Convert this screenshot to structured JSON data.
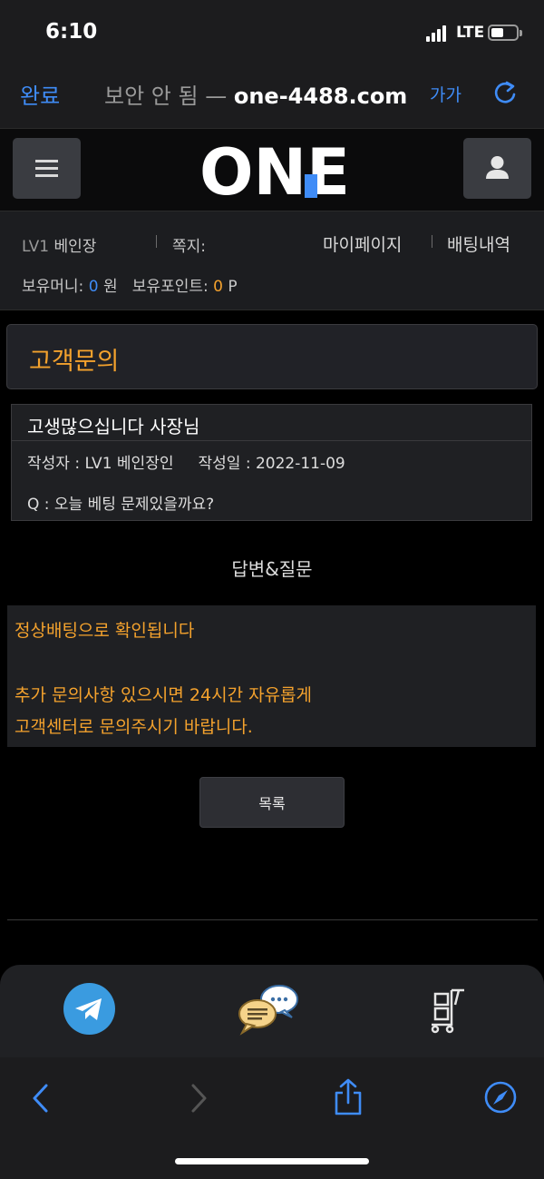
{
  "status_bar": {
    "time": "6:10",
    "network": "LTE"
  },
  "browser": {
    "done_label": "완료",
    "insecure_label": "보안 안 됨",
    "dash": "—",
    "domain": "one-4488.com",
    "text_size_label": "가가"
  },
  "header": {
    "logo_text": "ONE"
  },
  "user_info": {
    "level": "LV1",
    "name": "베인장",
    "memo_label": "쪽지:",
    "mypage_label": "마이페이지",
    "betting_history_label": "배팅내역",
    "money_label": "보유머니:",
    "money_value": "0",
    "money_unit": "원",
    "points_label": "보유포인트:",
    "points_value": "0",
    "points_unit": "P"
  },
  "page": {
    "title": "고객문의"
  },
  "question": {
    "subject": "고생많으십니다 사장님",
    "author_label": "작성자 : LV1 베인장인",
    "date_label": "작성일 : 2022-11-09",
    "body": "Q : 오늘 베팅 문제있을까요?"
  },
  "answer": {
    "heading": "답변&질문",
    "line1": "정상배팅으로 확인됩니다",
    "line2": "추가 문의사항 있으시면 24시간 자유롭게",
    "line3": "고객센터로 문의주시기 바랍니다."
  },
  "list_button_label": "목록",
  "colors": {
    "accent_orange": "#f4a22d",
    "accent_blue": "#3f8cf7",
    "panel": "#1f2023"
  }
}
